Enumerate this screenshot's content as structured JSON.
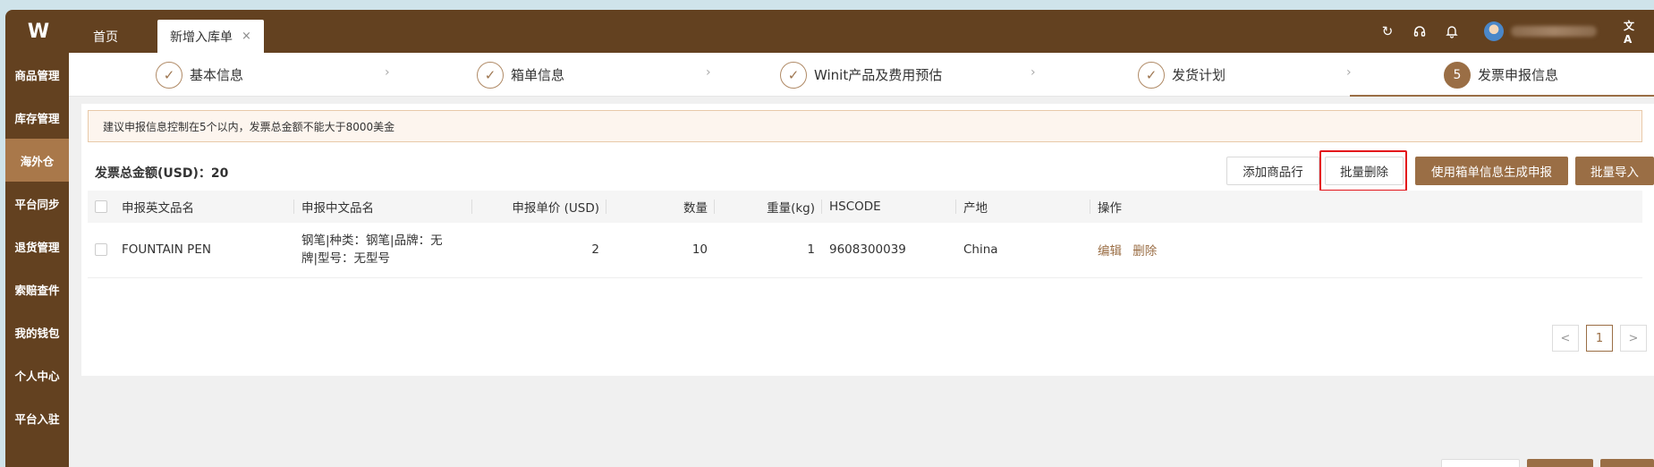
{
  "logo_text": "W",
  "tabs": [
    {
      "label": "首页"
    },
    {
      "label": "新增入库单",
      "close": "×"
    }
  ],
  "topbar_icons": [
    "refresh-icon",
    "headset-icon",
    "bell-icon",
    "translate-icon"
  ],
  "topbar_glyphs": {
    "refresh": "↻",
    "headset": "🎧",
    "bell": "🔔",
    "translate": "文A"
  },
  "sidebar": {
    "items": [
      {
        "label": "商品管理"
      },
      {
        "label": "库存管理"
      },
      {
        "label": "海外仓",
        "active": true
      },
      {
        "label": "平台同步"
      },
      {
        "label": "退货管理"
      },
      {
        "label": "索赔查件"
      },
      {
        "label": "我的钱包"
      },
      {
        "label": "个人中心"
      },
      {
        "label": "平台入驻"
      }
    ]
  },
  "steps": [
    {
      "label": "基本信息",
      "mark": "✓"
    },
    {
      "label": "箱单信息",
      "mark": "✓"
    },
    {
      "label": "Winit产品及费用预估",
      "mark": "✓"
    },
    {
      "label": "发货计划",
      "mark": "✓"
    },
    {
      "label": "发票申报信息",
      "mark": "5"
    }
  ],
  "step_separator": "›",
  "notice": "建议申报信息控制在5个以内，发票总金额不能大于8000美金",
  "invoice_total": "发票总金额(USD)：20",
  "buttons": {
    "add_row": "添加商品行",
    "batch_delete": "批量删除",
    "generate_from_box": "使用箱单信息生成申报",
    "batch_import": "批量导入"
  },
  "table": {
    "headers": [
      "申报英文品名",
      "申报中文品名",
      "申报单价 (USD)",
      "数量",
      "重量(kg)",
      "HSCODE",
      "产地",
      "操作"
    ],
    "rows": [
      {
        "en_name": "FOUNTAIN PEN",
        "cn_name": "钢笔|种类：钢笔|品牌：无牌|型号：无型号",
        "unit_price": "2",
        "quantity": "10",
        "weight": "1",
        "hscode": "9608300039",
        "origin": "China",
        "actions": [
          "编辑",
          "删除"
        ]
      }
    ]
  },
  "pagination": {
    "prev": "<",
    "current": "1",
    "next": ">"
  },
  "colors": {
    "brand": "#634120",
    "accent": "#9a6e45",
    "highlight": "#e3141b"
  }
}
